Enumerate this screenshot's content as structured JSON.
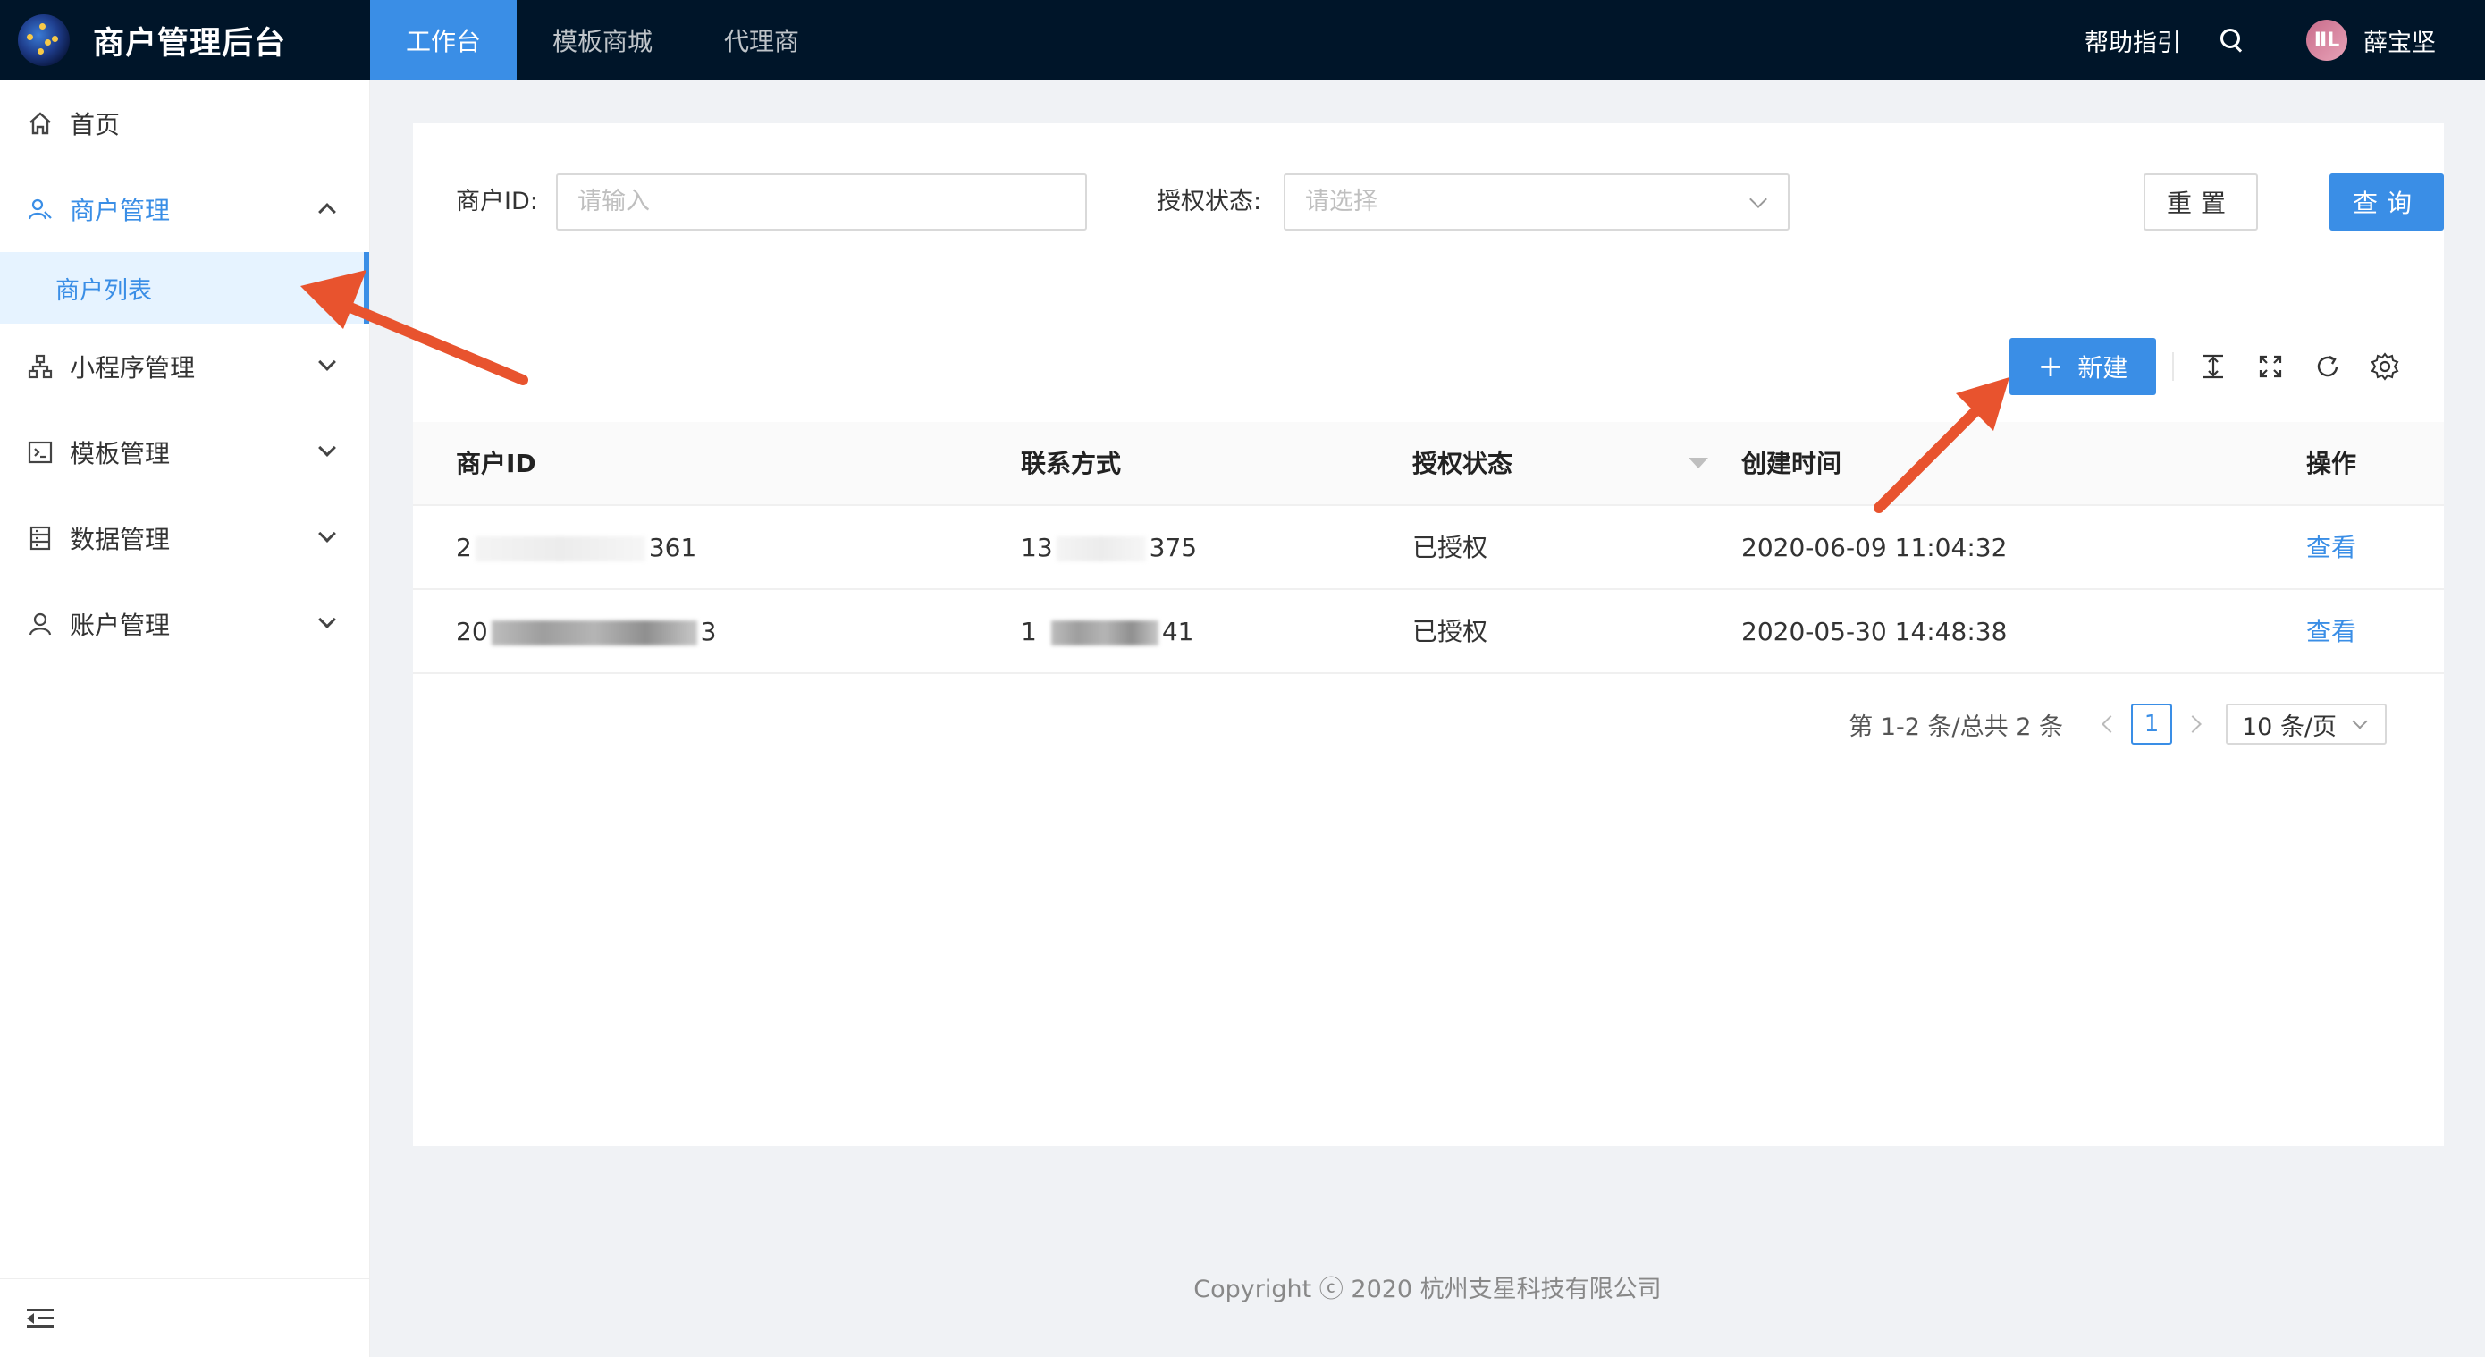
{
  "header": {
    "app_title": "商户管理后台",
    "nav": [
      "工作台",
      "模板商城",
      "代理商"
    ],
    "help": "帮助指引",
    "user": "薛宝坚",
    "avatar_text": "ⅡL"
  },
  "sidebar": {
    "home": "首页",
    "merchant": "商户管理",
    "merchant_list": "商户列表",
    "mini_program": "小程序管理",
    "template": "模板管理",
    "data": "数据管理",
    "account": "账户管理"
  },
  "filters": {
    "merchant_id_label": "商户ID:",
    "merchant_id_placeholder": "请输入",
    "auth_status_label": "授权状态:",
    "auth_status_placeholder": "请选择",
    "reset": "重置",
    "query": "查询"
  },
  "toolbar": {
    "new": "新建"
  },
  "table": {
    "columns": [
      "商户ID",
      "联系方式",
      "授权状态",
      "创建时间",
      "操作"
    ],
    "rows": [
      {
        "id_prefix": "2",
        "id_suffix": "361",
        "contact_prefix": "13",
        "contact_suffix": "375",
        "status": "已授权",
        "created": "2020-06-09 11:04:32",
        "action": "查看"
      },
      {
        "id_prefix": "20",
        "id_suffix": "3",
        "contact_prefix": "1",
        "contact_suffix": "41",
        "status": "已授权",
        "created": "2020-05-30 14:48:38",
        "action": "查看"
      }
    ]
  },
  "pagination": {
    "total": "第 1-2 条/总共 2 条",
    "current": "1",
    "page_size": "10 条/页"
  },
  "footer": "Copyright ⓒ 2020 杭州支星科技有限公司",
  "colors": {
    "primary": "#3a8ee6",
    "header_bg": "#001529",
    "annotation": "#e8532e"
  }
}
